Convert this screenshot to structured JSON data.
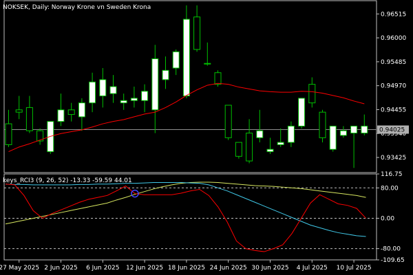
{
  "header": {
    "symbol": "NOKSEK",
    "timeframe": "Daily:",
    "description": "Norway Krone vn Sweden Krona"
  },
  "indicator": {
    "label": "keys_RCI3 (9, 26, 52) -13.33 -59.59 44.01"
  },
  "colors": {
    "background": "#000000",
    "frame": "#c0c0c0",
    "bull_body": "#ffffff",
    "bear_body": "#000000",
    "wick": "#00c000",
    "ma": "#ff0000",
    "rci_short": "#ff0000",
    "rci_mid": "#40c8e8",
    "rci_long": "#d8e860",
    "level_line": "#c0c0c0",
    "marker": "#4040ff"
  },
  "chart_data": [
    {
      "type": "candlestick",
      "title": "NOKSEK, Daily: Norway Krone vn Sweden Krona",
      "y_ticks": [
        "0.96515",
        "0.96000",
        "0.95485",
        "0.94970",
        "0.94455",
        "0.93940",
        "0.93425"
      ],
      "ylim": [
        0.931,
        0.968
      ],
      "current_price": "0.94025",
      "current_price_value": 0.94025,
      "x_ticks": [
        "27 May 2025",
        "2 Jun 2025",
        "6 Jun 2025",
        "12 Jun 2025",
        "18 Jun 2025",
        "24 Jun 2025",
        "30 Jun 2025",
        "4 Jul 2025",
        "10 Jul 2025"
      ],
      "x_tick_index": [
        1,
        5,
        9,
        13,
        17,
        21,
        25,
        29,
        33
      ],
      "candles": [
        {
          "o": 0.9415,
          "h": 0.9445,
          "l": 0.9365,
          "c": 0.937
        },
        {
          "o": 0.9445,
          "h": 0.9475,
          "l": 0.9425,
          "c": 0.944
        },
        {
          "o": 0.945,
          "h": 0.9475,
          "l": 0.9395,
          "c": 0.94
        },
        {
          "o": 0.94,
          "h": 0.9405,
          "l": 0.937,
          "c": 0.9378
        },
        {
          "o": 0.9355,
          "h": 0.942,
          "l": 0.935,
          "c": 0.942
        },
        {
          "o": 0.942,
          "h": 0.948,
          "l": 0.941,
          "c": 0.9445
        },
        {
          "o": 0.9445,
          "h": 0.946,
          "l": 0.942,
          "c": 0.9435
        },
        {
          "o": 0.943,
          "h": 0.947,
          "l": 0.94,
          "c": 0.946
        },
        {
          "o": 0.946,
          "h": 0.9525,
          "l": 0.944,
          "c": 0.9505
        },
        {
          "o": 0.9475,
          "h": 0.9535,
          "l": 0.945,
          "c": 0.951
        },
        {
          "o": 0.948,
          "h": 0.952,
          "l": 0.946,
          "c": 0.9495
        },
        {
          "o": 0.946,
          "h": 0.948,
          "l": 0.9445,
          "c": 0.9465
        },
        {
          "o": 0.9465,
          "h": 0.9495,
          "l": 0.945,
          "c": 0.947
        },
        {
          "o": 0.9465,
          "h": 0.95,
          "l": 0.944,
          "c": 0.9485
        },
        {
          "o": 0.9445,
          "h": 0.9585,
          "l": 0.9395,
          "c": 0.9555
        },
        {
          "o": 0.951,
          "h": 0.956,
          "l": 0.949,
          "c": 0.953
        },
        {
          "o": 0.9535,
          "h": 0.9575,
          "l": 0.952,
          "c": 0.957
        },
        {
          "o": 0.9475,
          "h": 0.967,
          "l": 0.947,
          "c": 0.964
        },
        {
          "o": 0.9645,
          "h": 0.967,
          "l": 0.957,
          "c": 0.9575
        },
        {
          "o": 0.9545,
          "h": 0.959,
          "l": 0.954,
          "c": 0.9545
        },
        {
          "o": 0.9525,
          "h": 0.953,
          "l": 0.9495,
          "c": 0.95
        },
        {
          "o": 0.9455,
          "h": 0.9455,
          "l": 0.938,
          "c": 0.9385
        },
        {
          "o": 0.9375,
          "h": 0.9375,
          "l": 0.934,
          "c": 0.9345
        },
        {
          "o": 0.9395,
          "h": 0.9425,
          "l": 0.933,
          "c": 0.9335
        },
        {
          "o": 0.9385,
          "h": 0.9445,
          "l": 0.9375,
          "c": 0.94
        },
        {
          "o": 0.9355,
          "h": 0.9385,
          "l": 0.935,
          "c": 0.936
        },
        {
          "o": 0.937,
          "h": 0.9405,
          "l": 0.9365,
          "c": 0.9375
        },
        {
          "o": 0.9375,
          "h": 0.942,
          "l": 0.9365,
          "c": 0.941
        },
        {
          "o": 0.941,
          "h": 0.947,
          "l": 0.9405,
          "c": 0.947
        },
        {
          "o": 0.95,
          "h": 0.9515,
          "l": 0.945,
          "c": 0.946
        },
        {
          "o": 0.944,
          "h": 0.9445,
          "l": 0.9375,
          "c": 0.9385
        },
        {
          "o": 0.936,
          "h": 0.941,
          "l": 0.9355,
          "c": 0.941
        },
        {
          "o": 0.939,
          "h": 0.941,
          "l": 0.9385,
          "c": 0.94
        },
        {
          "o": 0.9395,
          "h": 0.941,
          "l": 0.932,
          "c": 0.941
        },
        {
          "o": 0.9395,
          "h": 0.9435,
          "l": 0.939,
          "c": 0.941
        }
      ],
      "ma_values": [
        0.9355,
        0.9365,
        0.9372,
        0.938,
        0.9388,
        0.9394,
        0.9398,
        0.9402,
        0.9408,
        0.9415,
        0.942,
        0.9424,
        0.943,
        0.9436,
        0.944,
        0.945,
        0.9462,
        0.9476,
        0.9488,
        0.9498,
        0.9502,
        0.95,
        0.9494,
        0.949,
        0.9486,
        0.9484,
        0.9483,
        0.9483,
        0.9485,
        0.9484,
        0.9481,
        0.9476,
        0.9471,
        0.9464,
        0.9458
      ]
    },
    {
      "type": "line",
      "title": "keys_RCI3 (9, 26, 52) -13.33 -59.59 44.01",
      "y_ticks": [
        "116.75",
        "80.00",
        "0.00",
        "-80.00",
        "-109.65"
      ],
      "ylim": [
        -109.65,
        116.75
      ],
      "levels": [
        80,
        0,
        -80
      ],
      "series": [
        {
          "values": [
            90,
            88,
            60,
            20,
            0,
            12,
            22,
            32,
            42,
            50,
            55,
            60,
            72,
            85,
            65,
            62,
            62,
            62,
            62,
            66,
            72,
            76,
            60,
            30,
            -10,
            -60,
            -80,
            -85,
            -88,
            -80,
            -70,
            -40,
            0,
            40,
            62,
            50,
            38,
            34,
            26,
            0
          ]
        },
        {
          "values": [
            90,
            89,
            89,
            88,
            88,
            88,
            88,
            88,
            89,
            89,
            90,
            90,
            91,
            92,
            92,
            93,
            94,
            94,
            94,
            94,
            93,
            92,
            88,
            80,
            72,
            62,
            52,
            42,
            32,
            22,
            12,
            2,
            -8,
            -18,
            -25,
            -32,
            -38,
            -42,
            -46,
            -48
          ]
        },
        {
          "values": [
            -15,
            -10,
            -5,
            0,
            5,
            10,
            15,
            20,
            25,
            30,
            35,
            40,
            48,
            55,
            63,
            70,
            77,
            83,
            88,
            92,
            94,
            95,
            95,
            94,
            92,
            90,
            88,
            86,
            85,
            84,
            82,
            80,
            78,
            75,
            72,
            69,
            66,
            63,
            60,
            55
          ]
        }
      ],
      "marker_index": 14
    }
  ]
}
